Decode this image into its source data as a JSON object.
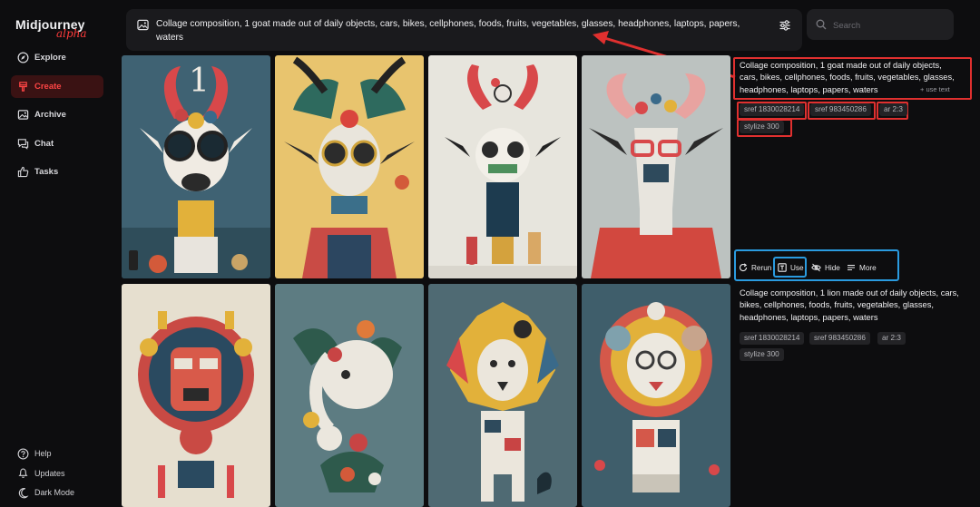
{
  "brand": {
    "name": "Midjourney",
    "sub": "alpha"
  },
  "nav": [
    {
      "label": "Explore",
      "icon": "compass-icon",
      "active": false
    },
    {
      "label": "Create",
      "icon": "brush-icon",
      "active": true
    },
    {
      "label": "Archive",
      "icon": "image-icon",
      "active": false
    },
    {
      "label": "Chat",
      "icon": "chat-icon",
      "active": false
    },
    {
      "label": "Tasks",
      "icon": "thumbs-up-icon",
      "active": false
    }
  ],
  "nav_bottom": [
    {
      "label": "Help",
      "icon": "help-icon"
    },
    {
      "label": "Updates",
      "icon": "bell-icon"
    },
    {
      "label": "Dark Mode",
      "icon": "moon-icon"
    }
  ],
  "prompt_bar": {
    "text": "Collage composition, 1 goat made out of daily objects, cars, bikes, cellphones, foods, fruits, vegetables, glasses, headphones, laptops, papers, waters"
  },
  "search": {
    "placeholder": "Search"
  },
  "goat_card": {
    "prompt": "Collage composition, 1 goat made out of daily objects, cars, bikes, cellphones, foods, fruits, vegetables, glasses, headphones, laptops, papers, waters",
    "use_text": "+ use text",
    "chips": [
      "sref 1830028214",
      "sref 983450286",
      "ar 2:3",
      "stylize 300"
    ],
    "number_label": "1",
    "actions": [
      "Rerun",
      "Use",
      "Hide",
      "More"
    ]
  },
  "lion_card": {
    "prompt": "Collage composition, 1 lion made out of daily objects, cars, bikes, cellphones, foods, fruits, vegetables, glasses, headphones, laptops, papers, waters",
    "chips": [
      "sref 1830028214",
      "sref 983450286",
      "ar 2:3",
      "stylize 300"
    ]
  },
  "colors": {
    "accent": "#ff3b3b",
    "highlight_red": "#e0302f",
    "highlight_blue": "#2a9be0",
    "background": "#0d0d0f"
  }
}
